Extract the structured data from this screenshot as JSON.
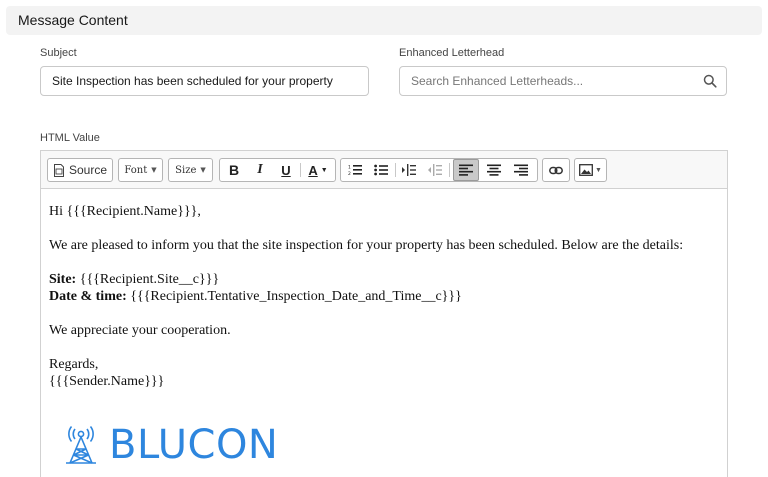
{
  "section": {
    "title": "Message Content"
  },
  "subject": {
    "label": "Subject",
    "value": "Site Inspection has been scheduled for your property"
  },
  "letterhead": {
    "label": "Enhanced Letterhead",
    "placeholder": "Search Enhanced Letterheads..."
  },
  "html_value": {
    "label": "HTML Value",
    "toolbar": {
      "source_label": "Source",
      "font_label": "Font",
      "size_label": "Size",
      "bold": "B",
      "italic": "I",
      "underline": "U",
      "text_color": "A"
    },
    "body": {
      "greeting": "Hi {{{Recipient.Name}}},",
      "intro": "We are pleased to inform you that the site inspection for your property has been scheduled. Below are the details:",
      "site_label": "Site:",
      "site_value": " {{{Recipient.Site__c}}}",
      "date_label": "Date & time:",
      "date_value": " {{{Recipient.Tentative_Inspection_Date_and_Time__c}}}",
      "appreciation": "We appreciate your cooperation.",
      "regards": "Regards,",
      "sender": "{{{Sender.Name}}}"
    },
    "logo_text": "BLUCON"
  },
  "colors": {
    "accent": "#2e86de",
    "active_button": "#c9c9c9",
    "header_bg": "#f3f3f3"
  }
}
